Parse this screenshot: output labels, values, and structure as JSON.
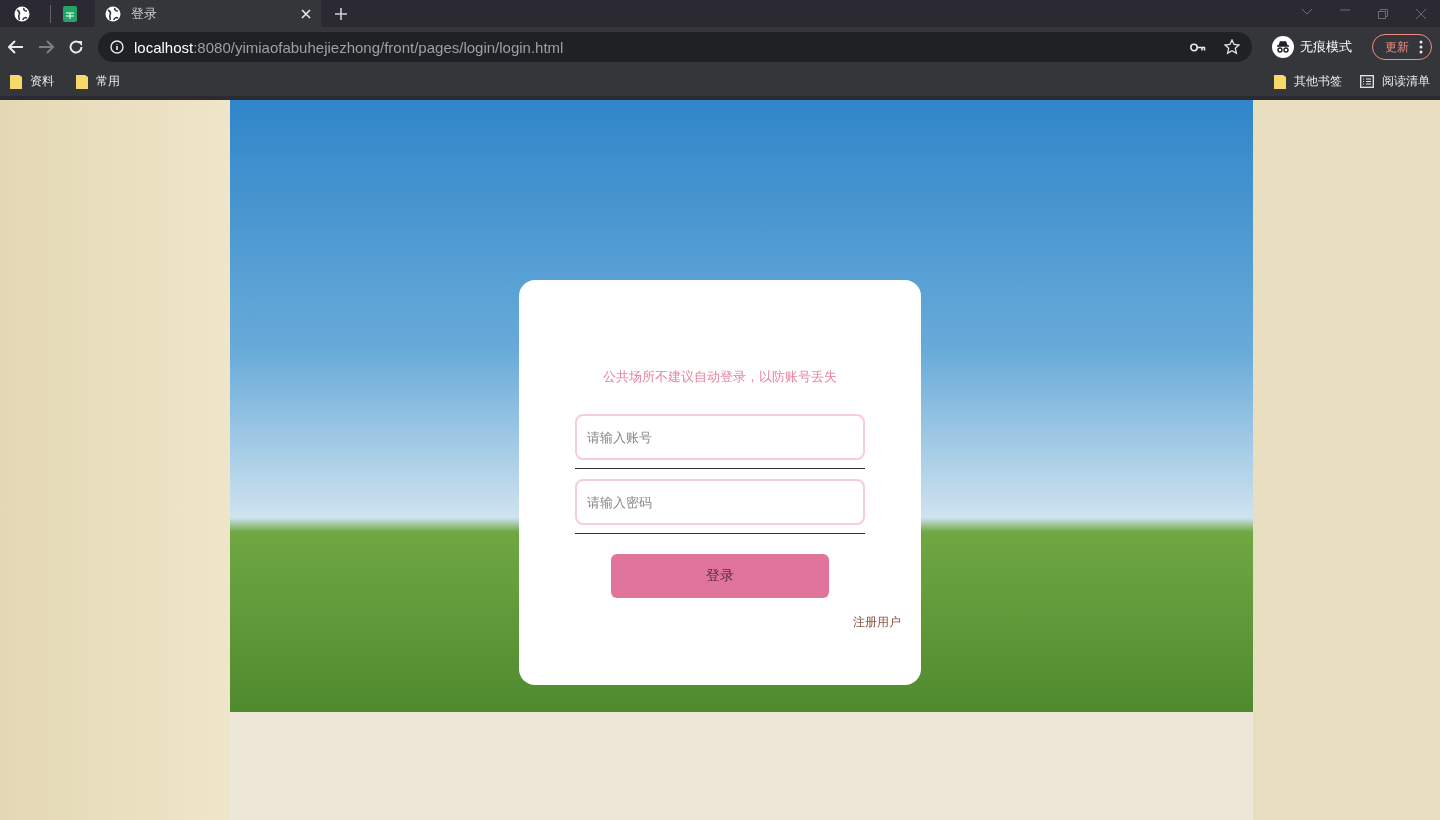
{
  "browser": {
    "tabs": [
      {
        "title": "登录",
        "selected": true
      }
    ],
    "url_host": "localhost",
    "url_path": ":8080/yimiaofabuhejiezhong/front/pages/login/login.html",
    "profile_label": "无痕模式",
    "update_label": "更新",
    "bookmarks": [
      {
        "label": "资料"
      },
      {
        "label": "常用"
      }
    ],
    "bookmarks_right": [
      {
        "kind": "folder",
        "label": "其他书签"
      },
      {
        "kind": "list",
        "label": "阅读清单"
      }
    ]
  },
  "login": {
    "notice": "公共场所不建议自动登录，以防账号丢失",
    "fields": [
      {
        "placeholder": "请输入账号"
      },
      {
        "placeholder": "请输入密码"
      }
    ],
    "submit": "登录",
    "register_link": "注册用户"
  }
}
